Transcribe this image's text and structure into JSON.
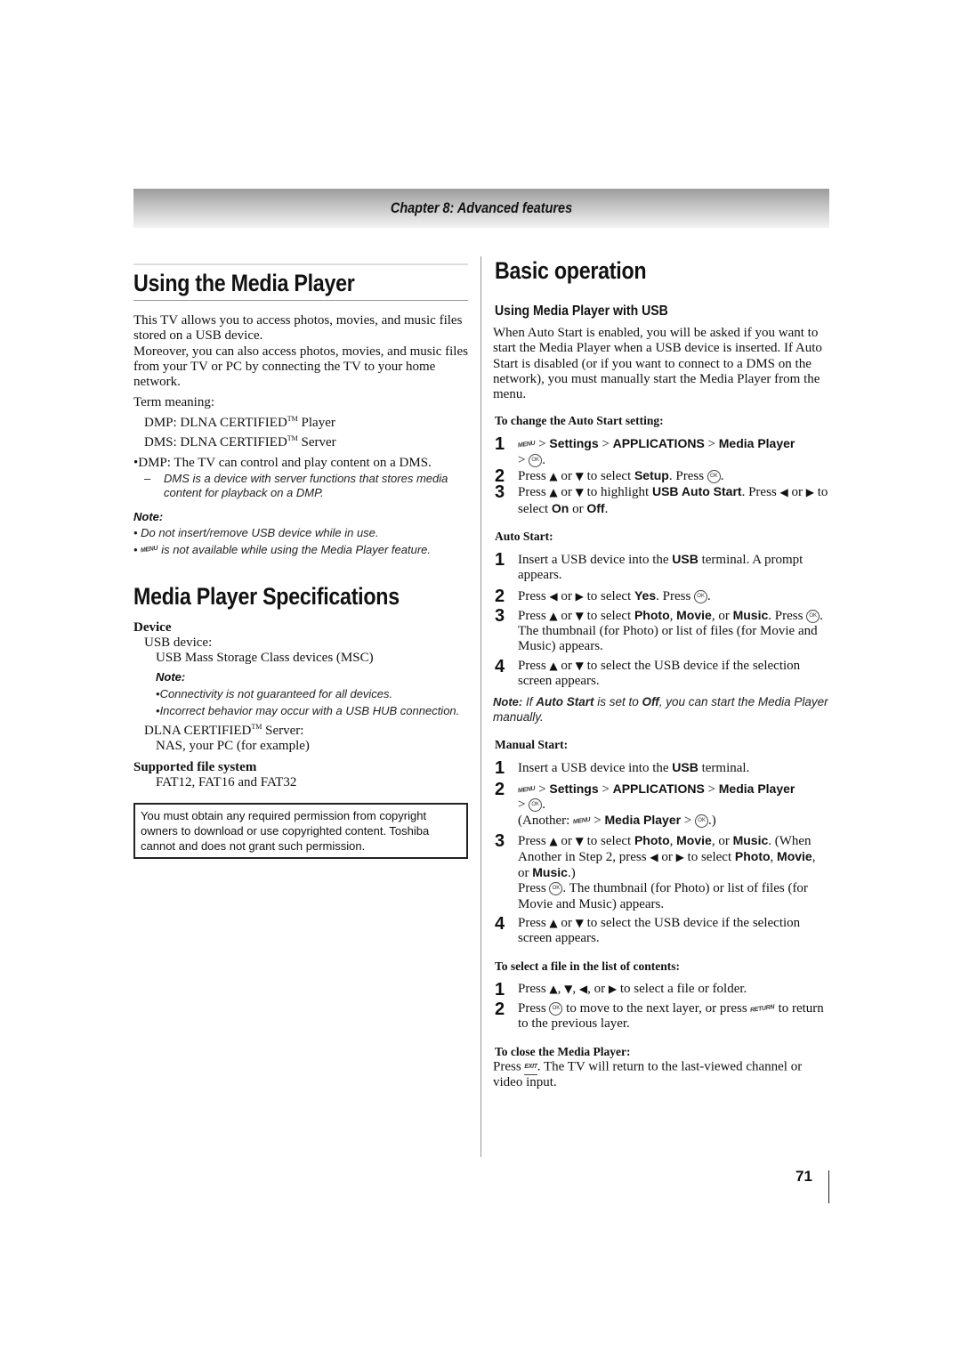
{
  "header": {
    "chapter": "Chapter 8: Advanced features"
  },
  "left": {
    "title": "Using the Media Player",
    "intro1": "This TV allows you to access photos, movies, and music files stored on a USB device.",
    "intro2": "Moreover, you can also access photos, movies, and music files from your TV or PC by connecting the TV to your home network.",
    "term_label": "Term meaning:",
    "term_dmp_a": "DMP: DLNA CERTIFIED",
    "term_dmp_b": " Player",
    "term_dms_a": "DMS: DLNA CERTIFIED",
    "term_dms_b": " Server",
    "tm": "TM",
    "bullet_dmp": "DMP: The TV can control and play content on a DMS.",
    "dash_dms": "DMS is a device with server functions that stores media content for playback on a DMP.",
    "note_label": "Note:",
    "note1": "Do not insert/remove USB device while in use.",
    "note2": "is not available while using the Media Player feature.",
    "menu_icon": "MENU",
    "spec_title": "Media Player Specifications",
    "device_head": "Device",
    "usb_device": "USB device:",
    "usb_msc": "USB Mass Storage Class devices (MSC)",
    "spec_note_label": "Note:",
    "spec_note1": "Connectivity is not guaranteed for all devices.",
    "spec_note2": "Incorrect behavior may occur with a USB HUB connection.",
    "dlna_server_a": "DLNA CERTIFIED",
    "dlna_server_b": " Server:",
    "nas": "NAS, your PC (for example)",
    "fs_head": "Supported file system",
    "fs_value": "FAT12, FAT16 and FAT32",
    "copyright": "You must obtain any required permission from copyright owners to download or use copyrighted content. Toshiba cannot and does not grant such permission."
  },
  "right": {
    "title": "Basic operation",
    "usb_head": "Using Media Player with USB",
    "usb_intro": "When Auto Start is enabled, you will be asked if you want to start the Media Player when a USB device is inserted. If Auto Start is disabled (or if you want to connect to a DMS on the network), you must manually start the Media Player from the menu.",
    "change_head": "To change the Auto Start setting:",
    "auto_head": "Auto Start:",
    "manual_head": "Manual Start:",
    "select_head": "To select a file in the list of contents:",
    "close_head": "To close the Media Player:",
    "icons": {
      "menu": "MENU",
      "ok": "OK",
      "return": "RETURN",
      "exit": "EXIT"
    },
    "words": {
      "settings": "Settings",
      "applications": "APPLICATIONS",
      "media_player": "Media Player",
      "setup": "Setup",
      "usb_auto_start": "USB Auto Start",
      "on": "On",
      "off": "Off",
      "usb": "USB",
      "yes": "Yes",
      "photo": "Photo",
      "movie": "Movie",
      "music": "Music",
      "auto_start": "Auto Start"
    },
    "auto_note_label": "Note:",
    "page_number": "71"
  }
}
